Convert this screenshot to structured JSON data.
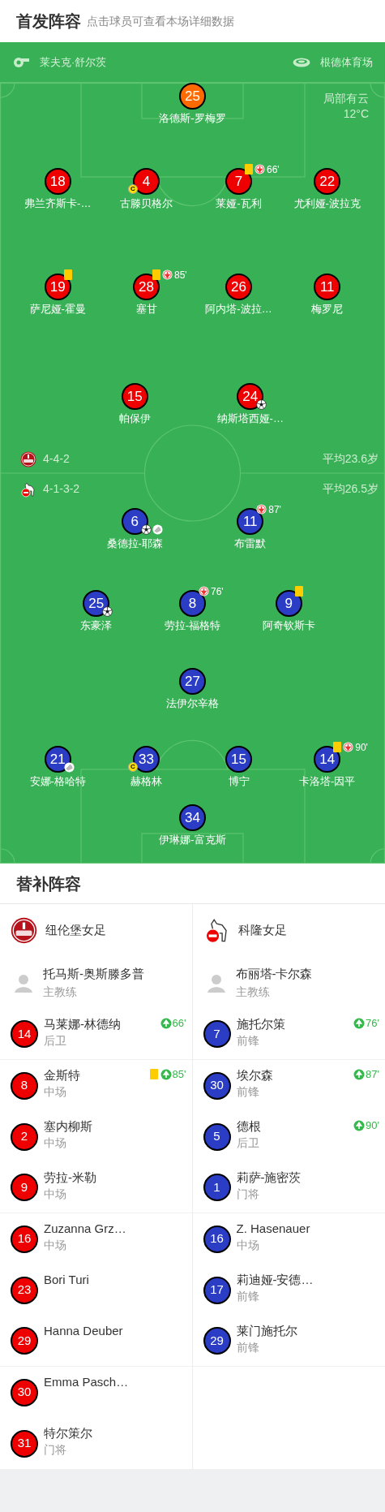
{
  "header": {
    "title": "首发阵容",
    "subtitle": "点击球员可查看本场详细数据"
  },
  "match_info": {
    "referee": "莱夫克·舒尔茨",
    "stadium": "根德体育场"
  },
  "weather": {
    "condition": "局部有云",
    "temperature": "12°C"
  },
  "teams": [
    {
      "formation": "4-4-2",
      "average_age": "平均23.6岁",
      "color": "#ee0000",
      "lines": [
        [
          {
            "number": "25",
            "name": "洛德斯-罗梅罗",
            "color": "#ff6a00"
          }
        ],
        [
          {
            "number": "18",
            "name": "弗兰齐斯卡-…"
          },
          {
            "number": "4",
            "name": "古滕贝格尔",
            "captain_badge": "C"
          },
          {
            "number": "7",
            "name": "莱娅-瓦利",
            "events": [
              {
                "kind": "yellow"
              },
              {
                "kind": "sub_off",
                "minute": "66'"
              }
            ]
          },
          {
            "number": "22",
            "name": "尤利娅-波拉克"
          }
        ],
        [
          {
            "number": "19",
            "name": "萨尼娅-霍曼",
            "events": [
              {
                "kind": "yellow"
              }
            ]
          },
          {
            "number": "28",
            "name": "塞甘",
            "events": [
              {
                "kind": "yellow"
              },
              {
                "kind": "sub_off",
                "minute": "85'"
              }
            ]
          },
          {
            "number": "26",
            "name": "阿内塔-波拉…"
          },
          {
            "number": "11",
            "name": "梅罗尼"
          }
        ],
        [
          {
            "number": "15",
            "name": "帕保伊"
          },
          {
            "number": "24",
            "name": "纳斯塔西娅-…",
            "events": [
              {
                "kind": "goal"
              }
            ]
          }
        ]
      ]
    },
    {
      "formation": "4-1-3-2",
      "average_age": "平均26.5岁",
      "color": "#2a3dc4",
      "lines": [
        [
          {
            "number": "6",
            "name": "桑德拉-耶森",
            "events": [
              {
                "kind": "goal"
              },
              {
                "kind": "assist"
              }
            ]
          },
          {
            "number": "11",
            "name": "布雷默",
            "events": [
              {
                "kind": "sub_off",
                "minute": "87'"
              }
            ]
          }
        ],
        [
          {
            "number": "25",
            "name": "东豪泽",
            "events": [
              {
                "kind": "goal"
              }
            ]
          },
          {
            "number": "8",
            "name": "劳拉-福格特",
            "events": [
              {
                "kind": "sub_off",
                "minute": "76'"
              }
            ]
          },
          {
            "number": "9",
            "name": "阿奇钦斯卡",
            "events": [
              {
                "kind": "yellow"
              }
            ]
          }
        ],
        [
          {
            "number": "27",
            "name": "法伊尔辛格"
          }
        ],
        [
          {
            "number": "21",
            "name": "安娜-格哈特",
            "events": [
              {
                "kind": "assist"
              }
            ]
          },
          {
            "number": "33",
            "name": "赫格林",
            "captain_badge": "C"
          },
          {
            "number": "15",
            "name": "博宁"
          },
          {
            "number": "14",
            "name": "卡洛塔-因平",
            "events": [
              {
                "kind": "yellow"
              },
              {
                "kind": "sub_off",
                "minute": "90'"
              }
            ]
          }
        ],
        [
          {
            "number": "34",
            "name": "伊琳娜-富克斯"
          }
        ]
      ]
    }
  ],
  "substitutes": {
    "title": "替补阵容",
    "teams": [
      {
        "name": "纽伦堡女足",
        "coach": {
          "name": "托马斯-奥斯滕多普",
          "role": "主教练"
        },
        "players": [
          {
            "number": "14",
            "name": "马莱娜-林德纳",
            "position": "后卫",
            "events": [
              {
                "kind": "sub_on",
                "minute": "66'"
              }
            ]
          },
          {
            "number": "8",
            "name": "金斯特",
            "position": "中场",
            "events": [
              {
                "kind": "yellow"
              },
              {
                "kind": "sub_on",
                "minute": "85'"
              }
            ]
          },
          {
            "number": "2",
            "name": "塞内柳斯",
            "position": "中场"
          },
          {
            "number": "9",
            "name": "劳拉-米勒",
            "position": "中场"
          },
          {
            "number": "16",
            "name": "Zuzanna Grz…",
            "position": "中场"
          },
          {
            "number": "23",
            "name": "Bori Turi"
          },
          {
            "number": "29",
            "name": "Hanna Deuber"
          },
          {
            "number": "30",
            "name": "Emma Pasch…"
          },
          {
            "number": "31",
            "name": "特尔策尔",
            "position": "门将"
          }
        ]
      },
      {
        "name": "科隆女足",
        "coach": {
          "name": "布丽塔-卡尔森",
          "role": "主教练"
        },
        "players": [
          {
            "number": "7",
            "name": "施托尔策",
            "position": "前锋",
            "events": [
              {
                "kind": "sub_on",
                "minute": "76'"
              }
            ]
          },
          {
            "number": "30",
            "name": "埃尔森",
            "position": "前锋",
            "events": [
              {
                "kind": "sub_on",
                "minute": "87'"
              }
            ]
          },
          {
            "number": "5",
            "name": "德根",
            "position": "后卫",
            "events": [
              {
                "kind": "sub_on",
                "minute": "90'"
              }
            ]
          },
          {
            "number": "1",
            "name": "莉萨-施密茨",
            "position": "门将"
          },
          {
            "number": "16",
            "name": "Z. Hasenauer",
            "position": "中场"
          },
          {
            "number": "17",
            "name": "莉迪娅-安德…",
            "position": "前锋"
          },
          {
            "number": "29",
            "name": "莱门施托尔",
            "position": "前锋"
          }
        ]
      }
    ]
  }
}
